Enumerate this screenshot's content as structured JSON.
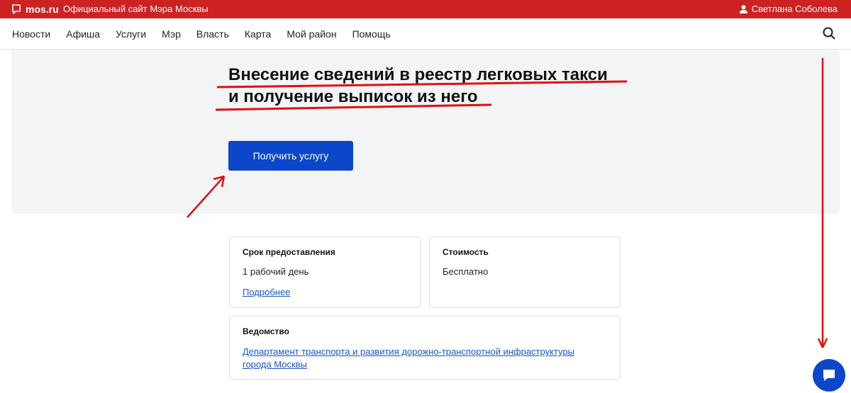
{
  "topbar": {
    "logo_text": "mos.ru",
    "site_desc": "Официальный сайт Мэра Москвы",
    "user_name": "Светлана Соболева"
  },
  "nav": {
    "items": [
      {
        "label": "Новости"
      },
      {
        "label": "Афиша"
      },
      {
        "label": "Услуги"
      },
      {
        "label": "Мэр"
      },
      {
        "label": "Власть"
      },
      {
        "label": "Карта"
      },
      {
        "label": "Мой район"
      },
      {
        "label": "Помощь"
      }
    ]
  },
  "hero": {
    "title_line1": "Внесение сведений в реестр легковых такси",
    "title_line2": "и получение выписок из него",
    "button_label": "Получить услугу"
  },
  "cards": {
    "term": {
      "heading": "Срок предоставления",
      "value": "1 рабочий день",
      "link": "Подробнее"
    },
    "cost": {
      "heading": "Стоимость",
      "value": "Бесплатно"
    },
    "agency": {
      "heading": "Ведомство",
      "link_line1": "Департамент транспорта и развития дорожно-транспортной инфраструктуры",
      "link_line2": "города Москвы"
    }
  },
  "colors": {
    "topbar": "#cc2222",
    "accent": "#0d47c9",
    "annotation": "#e01010"
  }
}
